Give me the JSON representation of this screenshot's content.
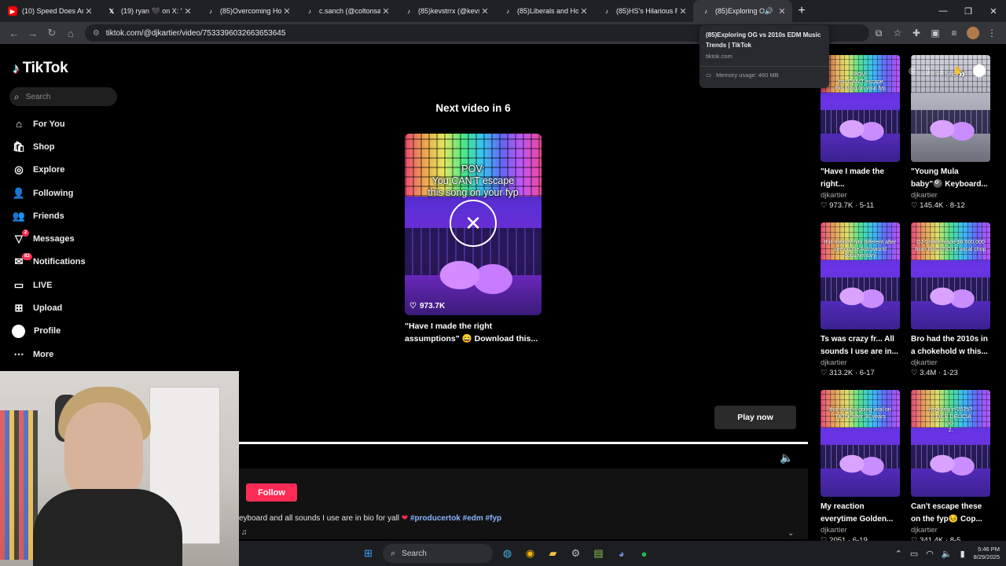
{
  "browser": {
    "tabs": [
      {
        "label": "(10) Speed Does Ame",
        "favicon": "youtube-icon",
        "color": "#ff0000"
      },
      {
        "label": "(19) ryan 🖤 on X: \"iSh",
        "favicon": "x-icon",
        "color": "#ffffff"
      },
      {
        "label": "(85)Overcoming Hope",
        "favicon": "tiktok-icon",
        "color": "#ffffff"
      },
      {
        "label": "c.sanch (@coltonsanc",
        "favicon": "tiktok-icon",
        "color": "#ffffff"
      },
      {
        "label": "(85)kevstrrx (@kevstr",
        "favicon": "tiktok-icon",
        "color": "#ffffff"
      },
      {
        "label": "(85)Liberals and Hous",
        "favicon": "tiktok-icon",
        "color": "#ffffff"
      },
      {
        "label": "(85)HS's Hilarious Rea",
        "favicon": "tiktok-icon",
        "color": "#ffffff"
      },
      {
        "label": "(85)Exploring OG",
        "favicon": "tiktok-icon",
        "color": "#ffffff",
        "active": true
      }
    ],
    "url": "tiktok.com/@djkartier/video/7533396032663653645",
    "tooltip": {
      "title": "(85)Exploring OG vs 2010s EDM Music Trends | TikTok",
      "domain": "tiktok.com",
      "memory": "Memory usage: 460 MB"
    }
  },
  "sidebar": {
    "brand": "TikTok",
    "search_placeholder": "Search",
    "items": [
      {
        "label": "For You",
        "icon": "home-icon"
      },
      {
        "label": "Shop",
        "icon": "shop-icon"
      },
      {
        "label": "Explore",
        "icon": "compass-icon"
      },
      {
        "label": "Following",
        "icon": "following-icon"
      },
      {
        "label": "Friends",
        "icon": "friends-icon"
      },
      {
        "label": "Messages",
        "icon": "messages-icon",
        "badge": "2"
      },
      {
        "label": "Notifications",
        "icon": "bell-icon",
        "badge": "83"
      },
      {
        "label": "LIVE",
        "icon": "live-icon"
      },
      {
        "label": "Upload",
        "icon": "upload-icon"
      },
      {
        "label": "Profile",
        "icon": "profile-icon"
      },
      {
        "label": "More",
        "icon": "more-icon"
      }
    ]
  },
  "player": {
    "next_label": "Next video in 6",
    "thumb_text": "POV:\nYou CAN'T escape\nthis song on your fyp",
    "likes": "973.7K",
    "caption": "\"Have I made the right assumptions\" 😄 Download this...",
    "play_now": "Play now",
    "follow": "Follow",
    "description_text": "eyboard and all sounds I use are in bio for yall",
    "description_tags": "#producertok #edm #fyp",
    "music_note": "♫"
  },
  "grid": {
    "cards": [
      {
        "title": "\"Have I made the right...",
        "user": "djkartier",
        "likes": "973.7K",
        "date": "5-11",
        "thumb": "POV:\nYou CAN'T escape\nthis song on your fyp"
      },
      {
        "title": "\"Young Mula baby\"🎱 Keyboard...",
        "user": "djkartier",
        "likes": "145.4K",
        "date": "8-12",
        "thumb": "the lyrics👀"
      },
      {
        "title": "Ts was crazy fr... All sounds I use are in...",
        "user": "djkartier",
        "likes": "313.2K",
        "date": "6-17",
        "thumb": "this melody hits different after seeing the Astroworld documentary"
      },
      {
        "title": "Bro had the 2010s in a chokehold w this...",
        "user": "djkartier",
        "likes": "3.4M",
        "date": "1-23",
        "thumb": "DJ Snake made $8,000,000 from this SINGLE vocal chop"
      },
      {
        "title": "My reaction everytime Golden...",
        "user": "djkartier",
        "likes": "2051",
        "date": "6-19",
        "thumb": "this song is going viral on TikTok after 30 years"
      },
      {
        "title": "Can't escape these on the fyp😣 Cop...",
        "user": "djkartier",
        "likes": "341.4K",
        "date": "8-5",
        "thumb": "fyp song in 2025?\n1. DILE DELICIA\nVs\n2."
      }
    ]
  },
  "taskbar": {
    "search": "Search",
    "time": "5:46 PM",
    "date": "8/29/2025"
  }
}
